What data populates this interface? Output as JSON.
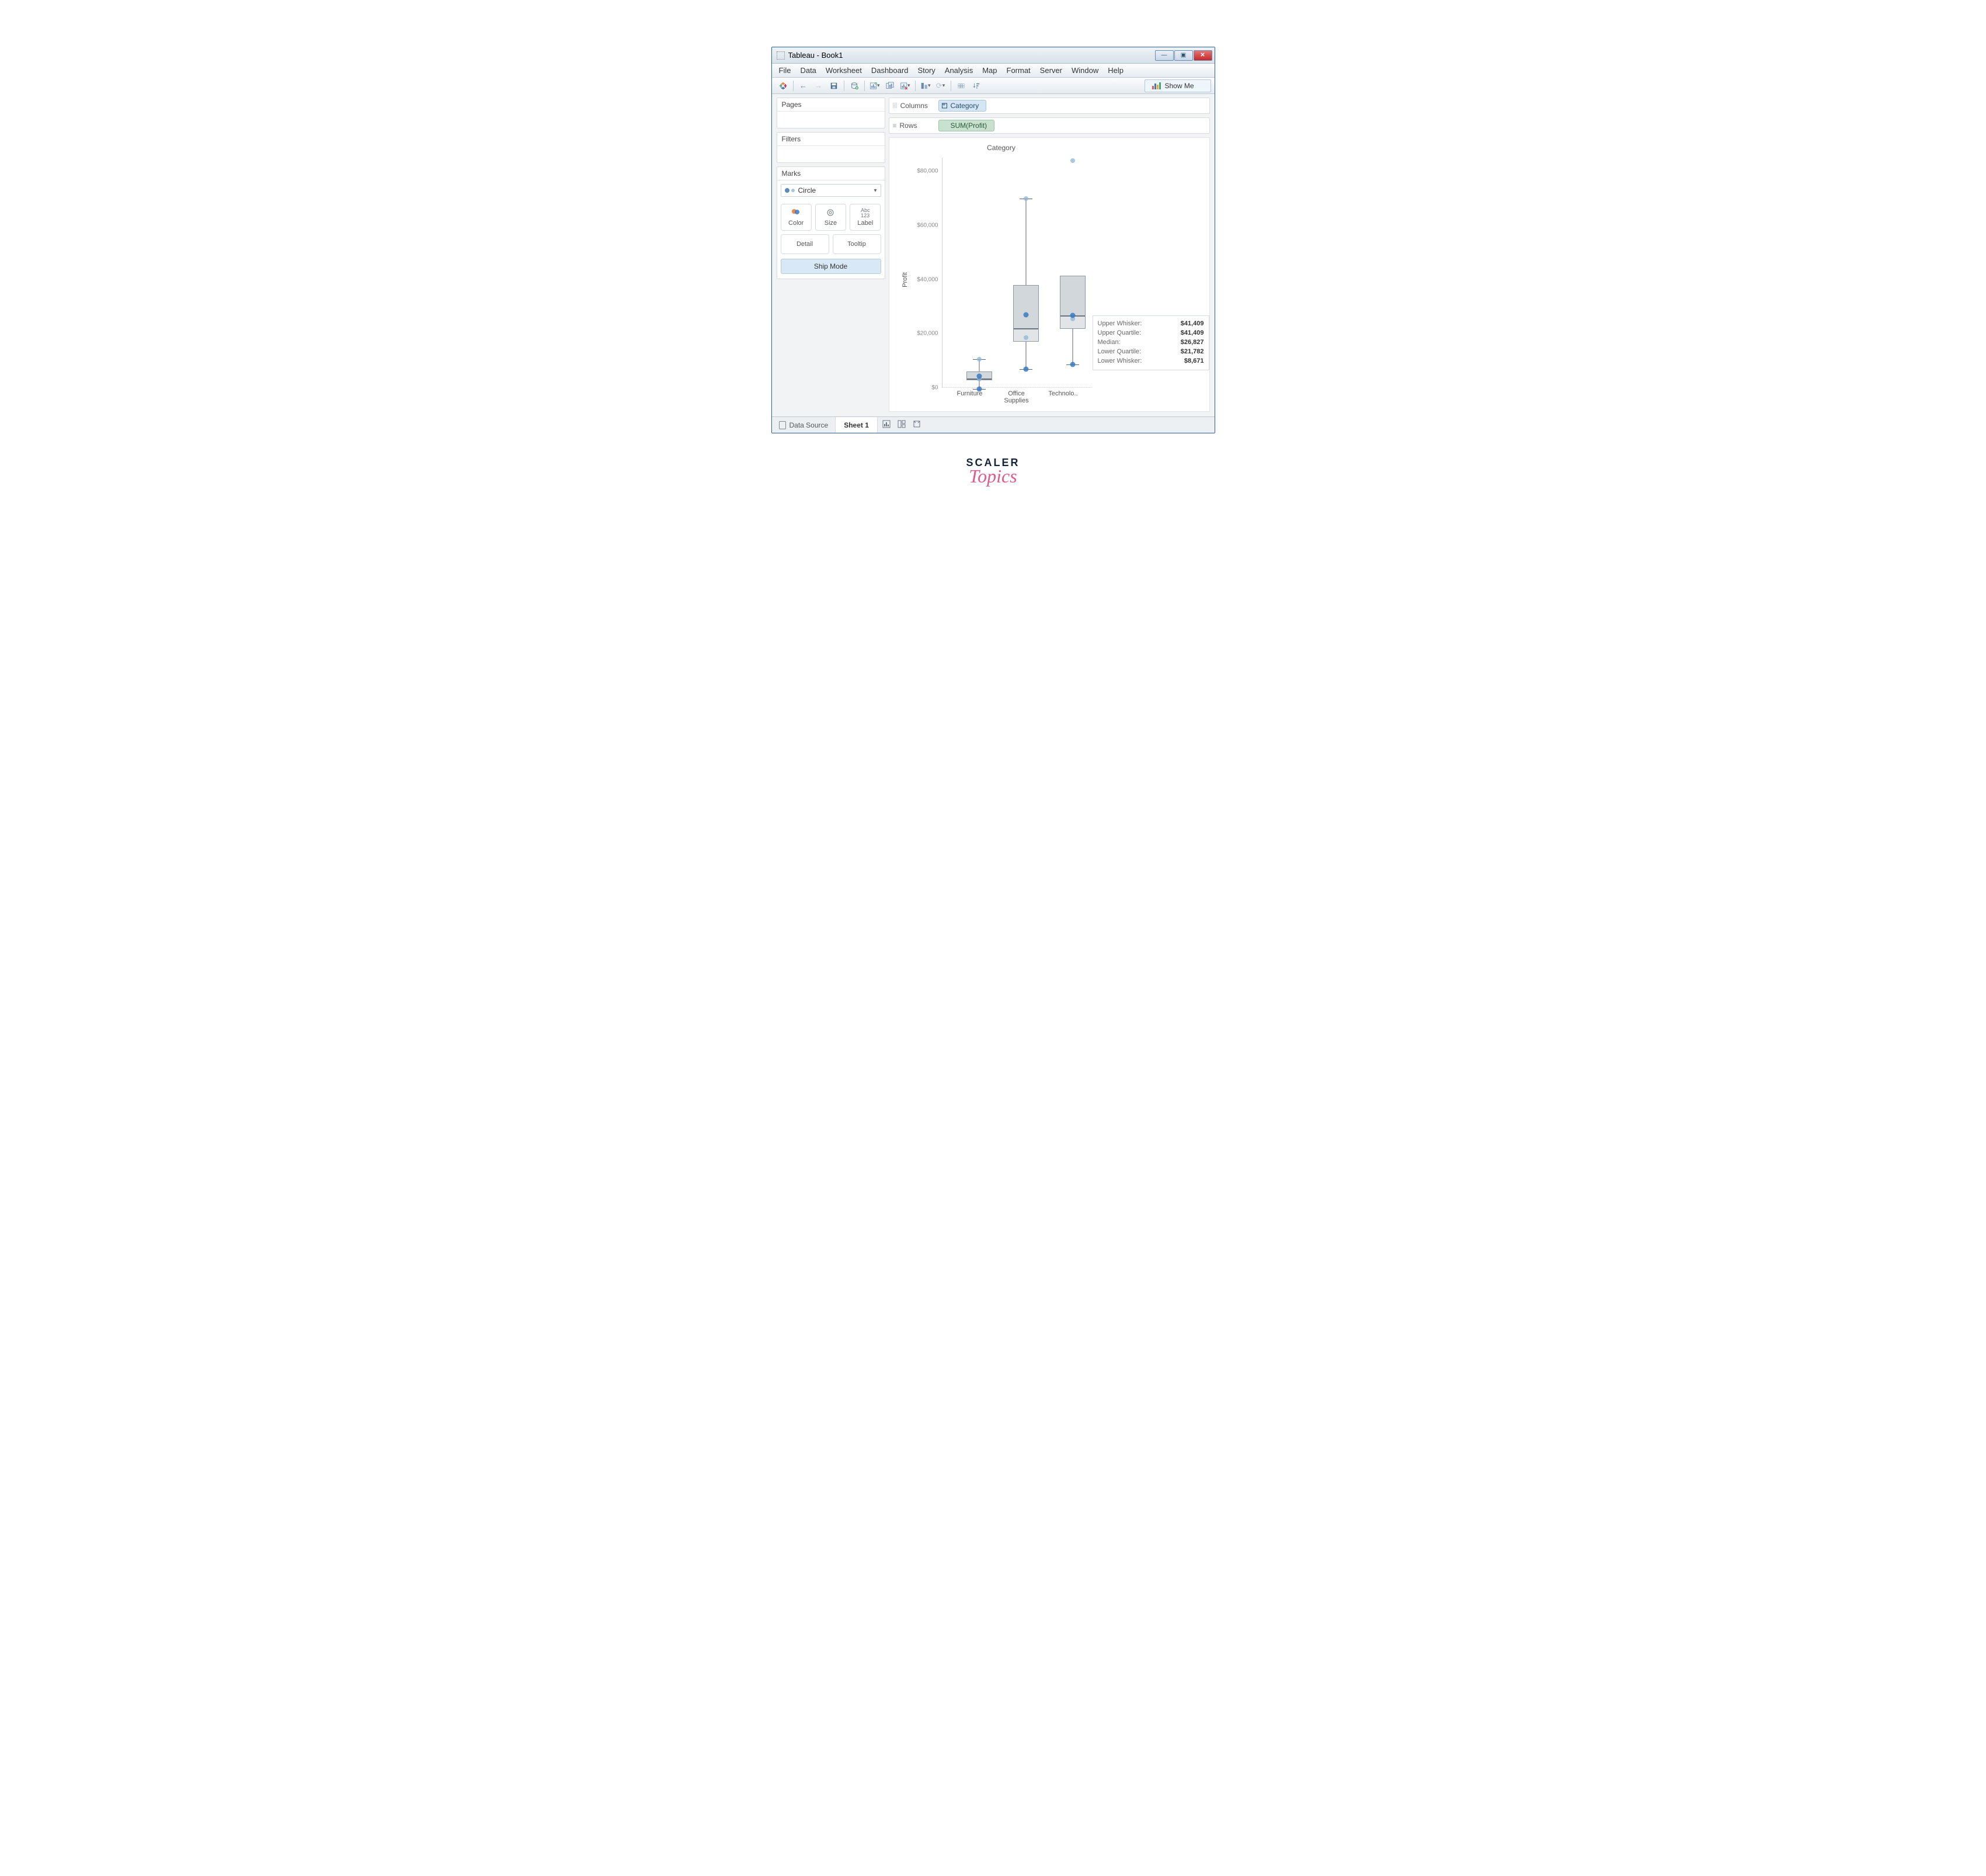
{
  "window": {
    "title": "Tableau - Book1"
  },
  "menubar": [
    "File",
    "Data",
    "Worksheet",
    "Dashboard",
    "Story",
    "Analysis",
    "Map",
    "Format",
    "Server",
    "Window",
    "Help"
  ],
  "toolbar": {
    "showme_label": "Show Me"
  },
  "left": {
    "pages_label": "Pages",
    "filters_label": "Filters",
    "marks_label": "Marks",
    "marks_type_label": "Circle",
    "mark_buttons": {
      "color": "Color",
      "size": "Size",
      "label": "Label",
      "detail": "Detail",
      "tooltip": "Tooltip",
      "abc": "Abc\n123"
    },
    "ship_mode_pill": "Ship Mode"
  },
  "shelves": {
    "columns_label": "Columns",
    "rows_label": "Rows",
    "columns_pill": "Category",
    "rows_pill": "SUM(Profit)"
  },
  "bottombar": {
    "data_source": "Data Source",
    "sheet1": "Sheet 1"
  },
  "tooltip": {
    "upper_whisker_label": "Upper Whisker:",
    "upper_whisker_value": "$41,409",
    "upper_quartile_label": "Upper Quartile:",
    "upper_quartile_value": "$41,409",
    "median_label": "Median:",
    "median_value": "$26,827",
    "lower_quartile_label": "Lower Quartile:",
    "lower_quartile_value": "$21,782",
    "lower_whisker_label": "Lower Whisker:",
    "lower_whisker_value": "$8,671"
  },
  "branding": {
    "line1": "SCALER",
    "line2": "Topics"
  },
  "chart_data": {
    "type": "boxplot",
    "title": "Category",
    "ylabel": "Profit",
    "ylim": [
      0,
      85000
    ],
    "yticks": [
      "$0",
      "$20,000",
      "$40,000",
      "$60,000",
      "$80,000"
    ],
    "categories": [
      "Furniture",
      "Office Supplies",
      "Technolo.."
    ],
    "series": [
      {
        "name": "Furniture",
        "lower_whisker": -500,
        "q1": 2800,
        "median": 3500,
        "q3": 6000,
        "upper_whisker": 10500,
        "points": [
          -500,
          3200,
          4400,
          10500
        ]
      },
      {
        "name": "Office Supplies",
        "lower_whisker": 7000,
        "q1": 17000,
        "median": 22000,
        "q3": 38000,
        "upper_whisker": 70000,
        "points": [
          7000,
          18500,
          27000,
          70000
        ]
      },
      {
        "name": "Technology",
        "lower_whisker": 8671,
        "q1": 21782,
        "median": 26827,
        "q3": 41409,
        "upper_whisker": 41409,
        "points": [
          8671,
          25500,
          26827,
          84000
        ]
      }
    ]
  }
}
